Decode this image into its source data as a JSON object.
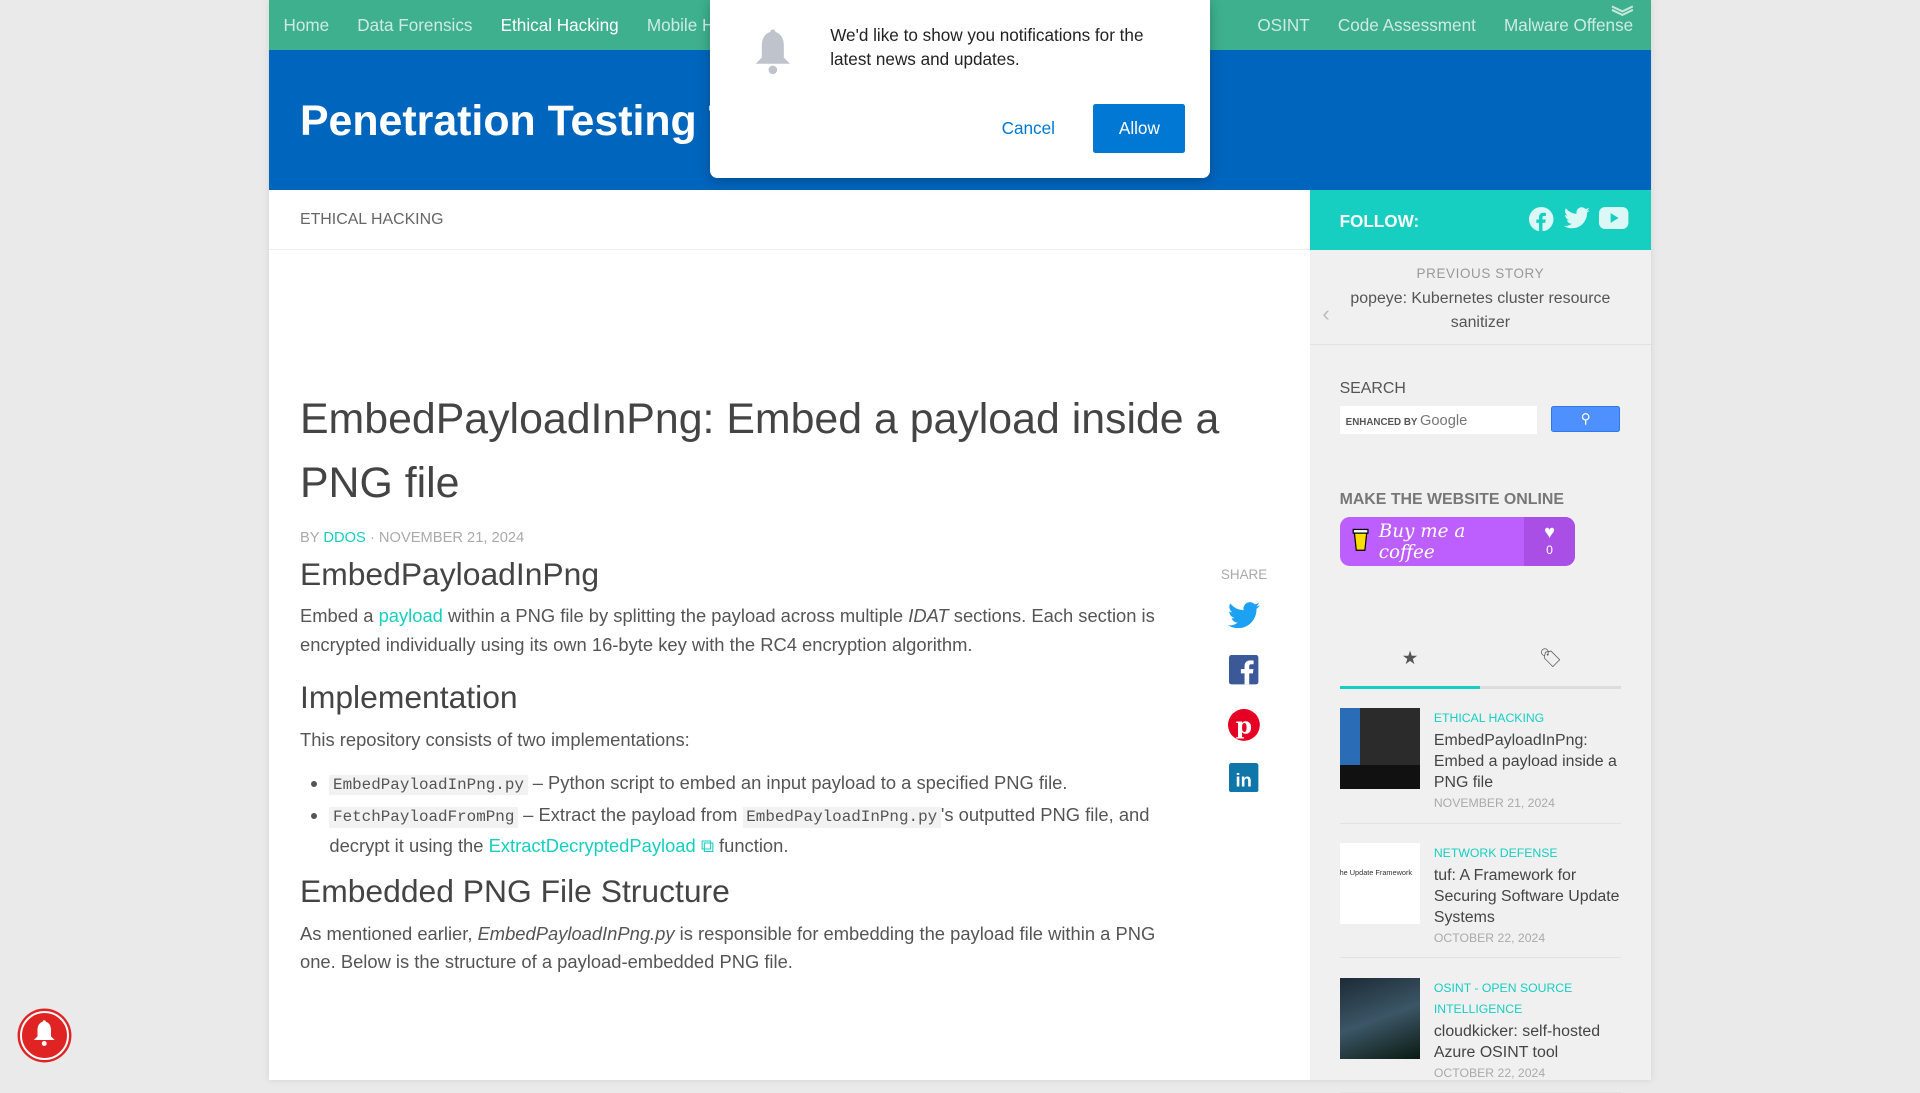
{
  "nav": {
    "items": [
      "Home",
      "Data Forensics",
      "Ethical Hacking",
      "Mobile Hacking",
      "",
      "",
      "",
      "OSINT",
      "Code Assessment",
      "Malware Offense"
    ],
    "active": "Ethical Hacking"
  },
  "header": {
    "site_title": "Penetration Testing Tools"
  },
  "article": {
    "category": "ETHICAL HACKING",
    "title": "EmbedPayloadInPng: Embed a payload inside a PNG file",
    "by": "BY",
    "author": "DDOS",
    "date": "· NOVEMBER 21, 2024",
    "h_intro": "EmbedPayloadInPng",
    "p1_a": "Embed a ",
    "p1_link": "payload",
    "p1_b": " within a PNG file by splitting the payload across multiple ",
    "p1_em": "IDAT",
    "p1_c": " sections. Each section is encrypted individually using its own 16-byte key with the RC4 encryption algorithm.",
    "h_impl": "Implementation",
    "p2": "This repository consists of two implementations:",
    "li1_code": "EmbedPayloadInPng.py",
    "li1_text": " – Python script to embed an input payload to a specified PNG file.",
    "li2_code": "FetchPayloadFromPng",
    "li2_a": " – Extract the payload from ",
    "li2_code2": "EmbedPayloadInPng.py",
    "li2_b": "'s outputted PNG file, and decrypt it using the ",
    "li2_link": "ExtractDecryptedPayload",
    "li2_c": " function.",
    "h_struct": "Embedded PNG File Structure",
    "p3_a": "As mentioned earlier, ",
    "p3_em": "EmbedPayloadInPng.py",
    "p3_b": " is responsible for embedding the payload file within a PNG one. Below is the structure of a payload-embedded PNG file."
  },
  "share": {
    "label": "SHARE",
    "icons": [
      "twitter-icon",
      "facebook-icon",
      "pinterest-icon",
      "linkedin-icon"
    ]
  },
  "sidebar": {
    "follow": "FOLLOW:",
    "prev_label": "PREVIOUS STORY",
    "prev_title": "popeye: Kubernetes cluster resource sanitizer",
    "search_title": "SEARCH",
    "search_placeholder_a": "ENHANCED BY",
    "search_placeholder_b": "Google",
    "donate_title": "MAKE THE WEBSITE ONLINE",
    "bmc_label": "Buy me a coffee",
    "bmc_count": "0",
    "posts": [
      {
        "cat": "ETHICAL HACKING",
        "title": "EmbedPayloadInPng: Embed a payload inside a PNG file",
        "date": "NOVEMBER 21, 2024"
      },
      {
        "cat": "NETWORK DEFENSE",
        "title": "tuf: A Framework for Securing Software Update Systems",
        "date": "OCTOBER 22, 2024",
        "thumb_text": "he Update Framework"
      },
      {
        "cat": "OSINT - OPEN SOURCE INTELLIGENCE",
        "title": "cloudkicker: self-hosted Azure OSINT tool",
        "date": "OCTOBER 22, 2024"
      }
    ]
  },
  "notification": {
    "message": "We'd like to show you notifications for the latest news and updates.",
    "cancel": "Cancel",
    "allow": "Allow"
  },
  "colors": {
    "nav": "#3eb08e",
    "header": "#0065bd",
    "accent": "#16cfc1",
    "allow": "#0078d4",
    "bmc": "#bd5fff"
  }
}
